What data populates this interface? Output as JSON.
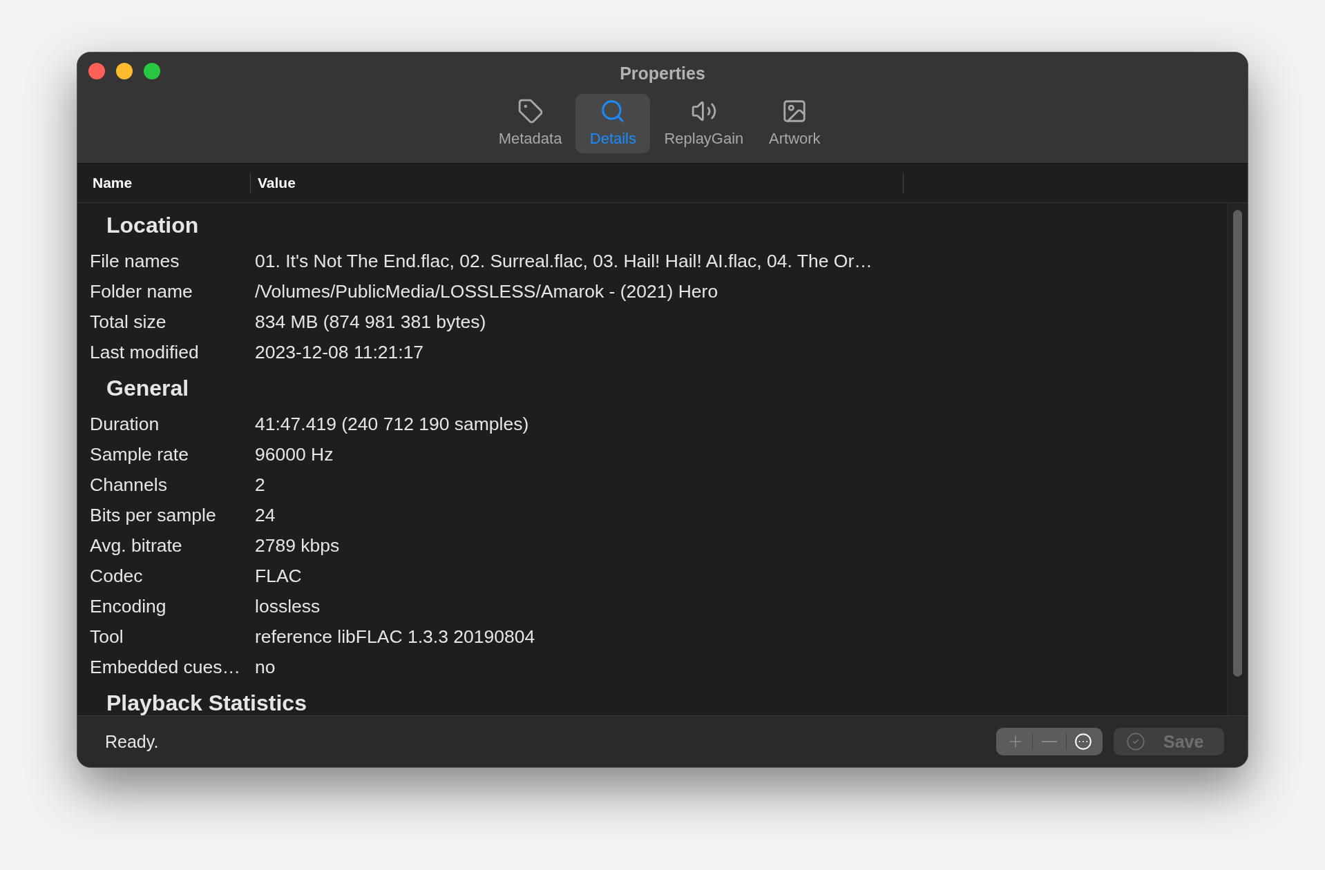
{
  "window": {
    "title": "Properties"
  },
  "tabs": [
    {
      "label": "Metadata",
      "kind": "tag",
      "selected": false
    },
    {
      "label": "Details",
      "kind": "search",
      "selected": true
    },
    {
      "label": "ReplayGain",
      "kind": "speaker",
      "selected": false
    },
    {
      "label": "Artwork",
      "kind": "image",
      "selected": false
    }
  ],
  "table": {
    "columns": [
      "Name",
      "Value"
    ],
    "sections": [
      {
        "title": "Location",
        "rows": [
          {
            "name": "File names",
            "value": "01. It's Not The End.flac, 02. Surreal.flac, 03. Hail! Hail! AI.flac, 04. The Or…"
          },
          {
            "name": "Folder name",
            "value": "/Volumes/PublicMedia/LOSSLESS/Amarok - (2021) Hero"
          },
          {
            "name": "Total size",
            "value": "834 MB (874 981 381 bytes)"
          },
          {
            "name": "Last modified",
            "value": "2023-12-08 11:21:17"
          }
        ]
      },
      {
        "title": "General",
        "rows": [
          {
            "name": "Duration",
            "value": "41:47.419 (240 712 190 samples)"
          },
          {
            "name": "Sample rate",
            "value": "96000 Hz"
          },
          {
            "name": "Channels",
            "value": "2"
          },
          {
            "name": "Bits per sample",
            "value": "24"
          },
          {
            "name": "Avg. bitrate",
            "value": "2789 kbps"
          },
          {
            "name": "Codec",
            "value": "FLAC"
          },
          {
            "name": "Encoding",
            "value": "lossless"
          },
          {
            "name": "Tool",
            "value": "reference libFLAC 1.3.3 20190804"
          },
          {
            "name": "Embedded cues…",
            "value": "no"
          }
        ]
      },
      {
        "title": "Playback Statistics"
      }
    ]
  },
  "status_bar": {
    "text": "Ready.",
    "tools": [
      {
        "kind": "plus",
        "disabled": true
      },
      {
        "kind": "minus",
        "disabled": true
      },
      {
        "kind": "more",
        "disabled": false
      }
    ],
    "save": {
      "label": "Save",
      "disabled": true
    }
  }
}
